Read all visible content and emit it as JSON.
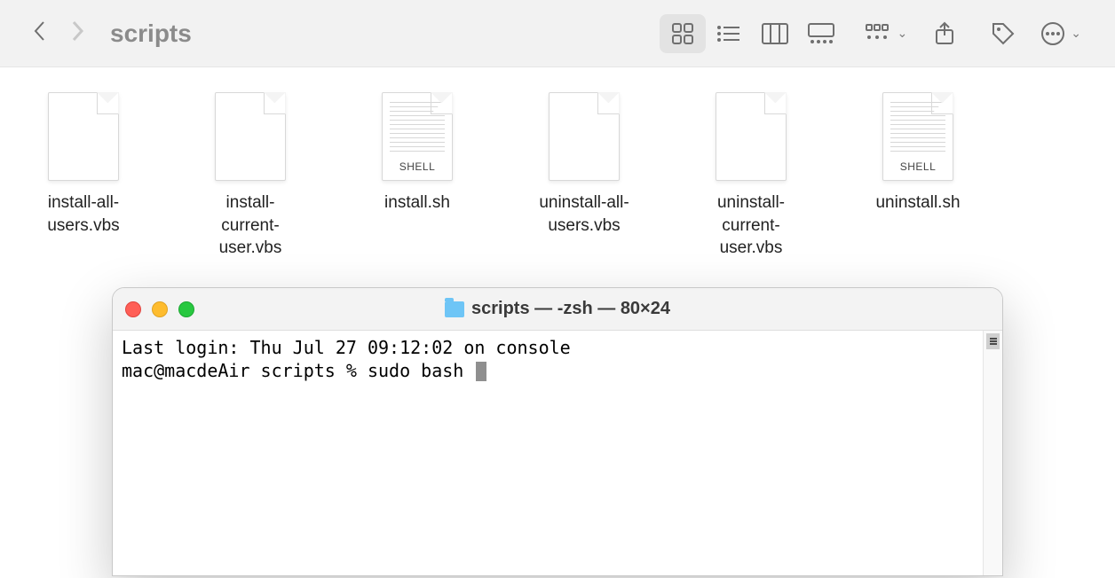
{
  "finder": {
    "title": "scripts",
    "files": [
      {
        "name": "install-all-users.vbs",
        "type": "blank"
      },
      {
        "name": "install-current-user.vbs",
        "type": "blank"
      },
      {
        "name": "install.sh",
        "type": "shell",
        "badge": "SHELL"
      },
      {
        "name": "uninstall-all-users.vbs",
        "type": "blank"
      },
      {
        "name": "uninstall-current-user.vbs",
        "type": "blank"
      },
      {
        "name": "uninstall.sh",
        "type": "shell",
        "badge": "SHELL"
      }
    ]
  },
  "terminal": {
    "title": "scripts — -zsh — 80×24",
    "last_login": "Last login: Thu Jul 27 09:12:02 on console",
    "prompt": "mac@macdeAir scripts % sudo bash "
  }
}
